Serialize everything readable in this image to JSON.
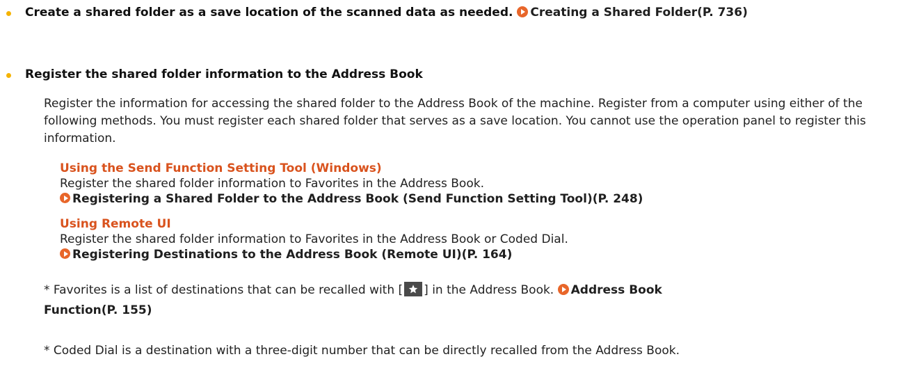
{
  "bullets": {
    "b1_text": "Create a shared folder as a save location of the scanned data as needed. ",
    "b1_link": "Creating a Shared Folder(P. 736)",
    "b2_text": "Register the shared folder information to the Address Book"
  },
  "intro": "Register the information for accessing the shared folder to the Address Book of the machine. Register from a computer using either of the following methods. You must register each shared folder that serves as a save location. You cannot use the operation panel to register this information.",
  "methods": [
    {
      "title": "Using the Send Function Setting Tool (Windows)",
      "desc": "Register the shared folder information to Favorites in the Address Book.",
      "link": "Registering a Shared Folder to the Address Book (Send Function Setting Tool)(P. 248)"
    },
    {
      "title": "Using Remote UI",
      "desc": "Register the shared folder information to Favorites in the Address Book or Coded Dial.",
      "link": "Registering Destinations to the Address Book (Remote UI)(P. 164)"
    }
  ],
  "notes": {
    "n1_before": "* Favorites is a list of destinations that can be recalled with [",
    "n1_after": "] in the Address Book. ",
    "n1_link": "Address Book Function(P. 155)",
    "n2": "* Coded Dial is a destination with a three-digit number that can be directly recalled from the Address Book."
  },
  "colors": {
    "bullet": "#f5b300",
    "link_arrow": "#e8662a",
    "method_heading": "#d9531e"
  },
  "icons": {
    "link": "circle-arrow-icon",
    "favorites": "star-icon"
  }
}
